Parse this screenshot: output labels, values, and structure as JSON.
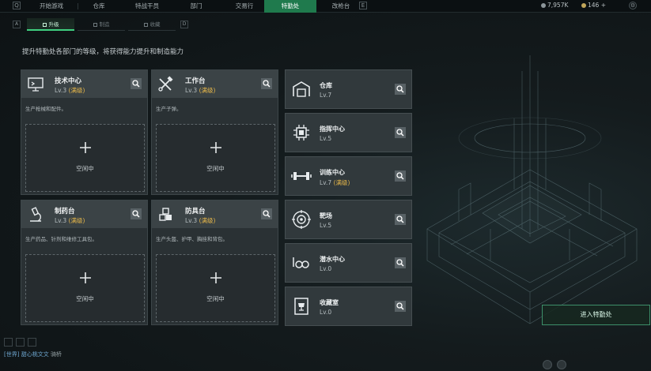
{
  "nav": {
    "left_key": "Q",
    "right_key": "E",
    "tabs": [
      {
        "label": "开始游戏",
        "active": false
      },
      {
        "label": "仓库",
        "active": false
      },
      {
        "label": "特战干员",
        "active": false
      },
      {
        "label": "部门",
        "active": false
      },
      {
        "label": "交易行",
        "active": false
      },
      {
        "label": "特勤处",
        "active": true
      },
      {
        "label": "改枪台",
        "active": false
      }
    ],
    "currency_1": "7,957K",
    "currency_2": "146 +"
  },
  "subtabs": {
    "left_key": "A",
    "right_key": "D",
    "items": [
      {
        "label": "升级",
        "active": true
      },
      {
        "label": "制造",
        "active": false
      },
      {
        "label": "收藏",
        "active": false
      }
    ]
  },
  "intro": "提升特勤处各部门的等级，将获得能力提升和制造能力",
  "cards": [
    {
      "icon": "computer-icon",
      "title": "技术中心",
      "level": "Lv.3",
      "max": "(满级)",
      "desc": "生产枪械和配件。",
      "slot": "空闲中"
    },
    {
      "icon": "tools-icon",
      "title": "工作台",
      "level": "Lv.3",
      "max": "(满级)",
      "desc": "生产子弹。",
      "slot": "空闲中"
    },
    {
      "icon": "microscope-icon",
      "title": "制药台",
      "level": "Lv.3",
      "max": "(满级)",
      "desc": "生产药品、针剂和维修工具包。",
      "slot": "空闲中"
    },
    {
      "icon": "cubes-icon",
      "title": "防具台",
      "level": "Lv.3",
      "max": "(满级)",
      "desc": "生产头盔、护甲、胸挂和背包。",
      "slot": "空闲中"
    }
  ],
  "rows": [
    {
      "icon": "warehouse-icon",
      "title": "仓库",
      "level": "Lv.7",
      "max": ""
    },
    {
      "icon": "chip-icon",
      "title": "指挥中心",
      "level": "Lv.5",
      "max": ""
    },
    {
      "icon": "dumbbell-icon",
      "title": "训练中心",
      "level": "Lv.7",
      "max": "(满级)"
    },
    {
      "icon": "target-icon",
      "title": "靶场",
      "level": "Lv.5",
      "max": ""
    },
    {
      "icon": "diving-mask-icon",
      "title": "潜水中心",
      "level": "Lv.0",
      "max": ""
    },
    {
      "icon": "trophy-icon",
      "title": "收藏室",
      "level": "Lv.0",
      "max": ""
    }
  ],
  "enter_button": "进入特勤处",
  "chat": {
    "channel": "[世界]",
    "user": "甜心桃文文",
    "message": "骑桥"
  },
  "colors": {
    "accent": "#1f7a4d",
    "max_level": "#e8b84a"
  }
}
